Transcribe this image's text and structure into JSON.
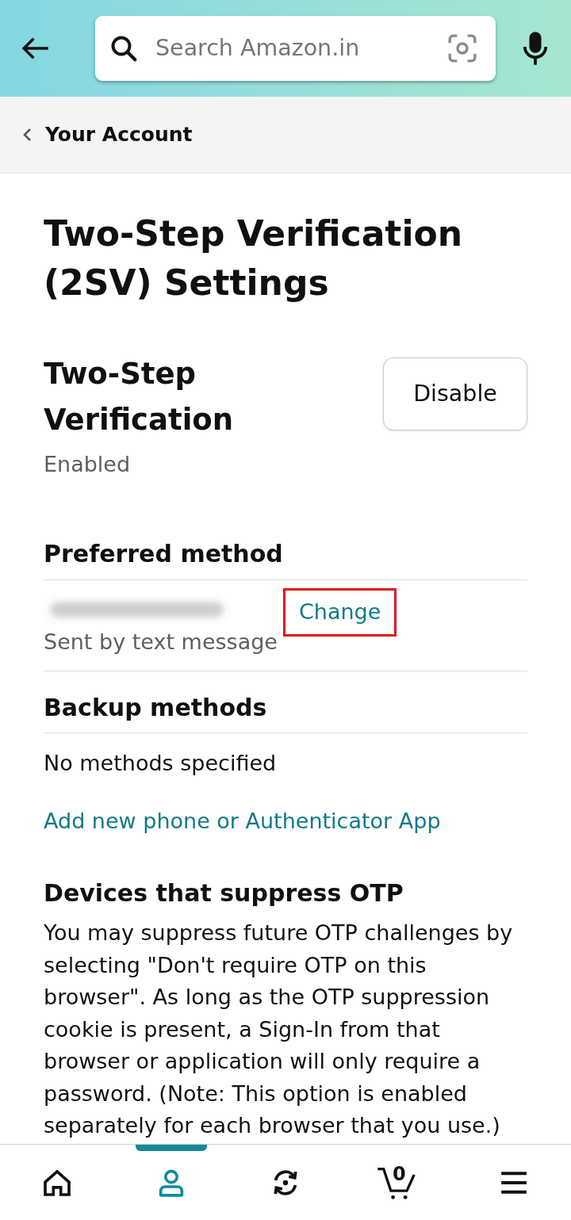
{
  "header": {
    "search": {
      "placeholder": "Search Amazon.in"
    }
  },
  "breadcrumb": {
    "label": "Your Account"
  },
  "page_title": "Two-Step Verification (2SV) Settings",
  "status_section": {
    "title": "Two-Step Verification",
    "status": "Enabled",
    "button": "Disable"
  },
  "preferred_method": {
    "title": "Preferred method",
    "action": {
      "label": "Change",
      "highlighted": true
    },
    "detail": "Sent by text message"
  },
  "backup_methods": {
    "title": "Backup methods",
    "empty_text": "No methods specified",
    "add_link": "Add new phone or Authenticator App"
  },
  "devices": {
    "title": "Devices that suppress OTP",
    "description": "You may suppress future OTP challenges by selecting \"Don't require OTP on this browser\". As long as the OTP suppression cookie is present, a Sign-In from that browser or application will only require a password. (Note: This option is enabled separately for each browser that you use.)"
  },
  "bottom_nav": [
    {
      "kind": "home",
      "selected": false
    },
    {
      "kind": "account",
      "selected": true
    },
    {
      "kind": "sync",
      "selected": false
    },
    {
      "kind": "cart",
      "count": "0",
      "selected": false
    },
    {
      "kind": "menu",
      "selected": false
    }
  ]
}
